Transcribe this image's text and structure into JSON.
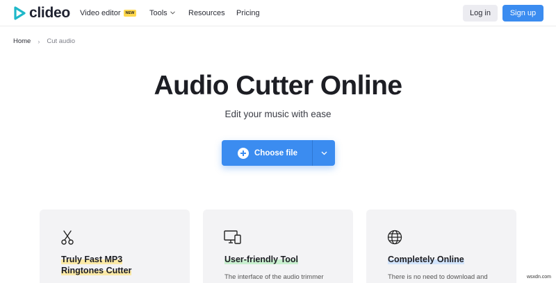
{
  "colors": {
    "brand": "#3b8cf0",
    "logo_teal": "#1fb8c9",
    "badge": "#ffd84d",
    "card_bg": "#f3f3f5"
  },
  "nav": {
    "logo_text": "clideo",
    "links": {
      "video_editor": "Video editor",
      "video_editor_badge": "NEW",
      "tools": "Tools",
      "resources": "Resources",
      "pricing": "Pricing"
    },
    "login": "Log in",
    "signup": "Sign up"
  },
  "breadcrumb": {
    "home": "Home",
    "separator": "›",
    "current": "Cut audio"
  },
  "hero": {
    "title": "Audio Cutter Online",
    "subtitle": "Edit your music with ease",
    "choose_file": "Choose file"
  },
  "cards": [
    {
      "icon": "scissors-icon",
      "title_line1": "Truly Fast MP3",
      "title_line2": "Ringtones Cutter"
    },
    {
      "icon": "devices-icon",
      "title": "User-friendly Tool",
      "text": "The interface of the audio trimmer"
    },
    {
      "icon": "globe-icon",
      "title": "Completely Online",
      "text": "There is no need to download and"
    }
  ],
  "watermark": "wsxdn.com"
}
